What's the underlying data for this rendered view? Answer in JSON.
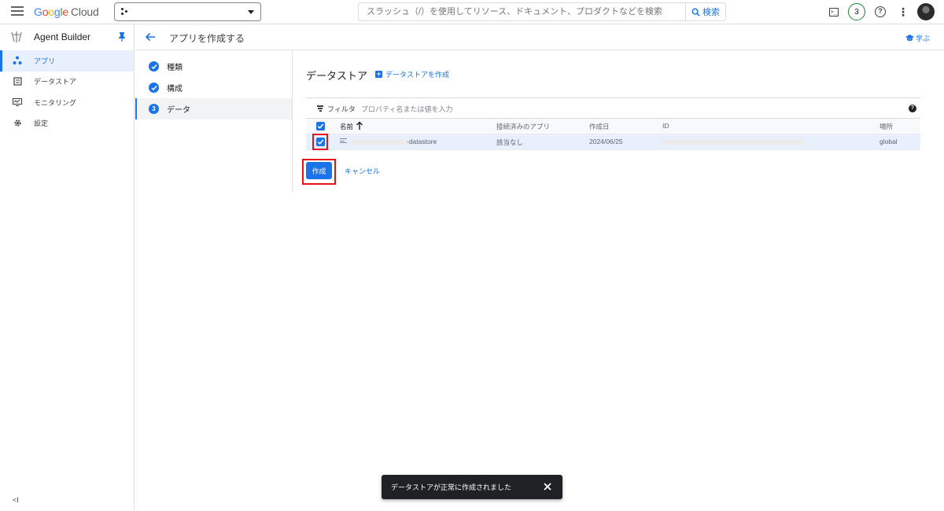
{
  "topbar": {
    "logo": {
      "g1": "G",
      "o1": "o",
      "o2": "o",
      "g2": "g",
      "l": "l",
      "e": "e",
      "cloud": "Cloud"
    },
    "search_placeholder": "スラッシュ（/）を使用してリソース、ドキュメント、プロダクトなどを検索",
    "search_button": "検索",
    "notification_count": "3",
    "help_glyph": "?",
    "more_glyph": "⋮",
    "terminal_glyph": ">_"
  },
  "sidebar": {
    "product_title": "Agent Builder",
    "items": [
      {
        "label": "アプリ",
        "icon": "apps-icon",
        "active": true
      },
      {
        "label": "データストア",
        "icon": "datastore-icon",
        "active": false
      },
      {
        "label": "モニタリング",
        "icon": "monitoring-icon",
        "active": false
      },
      {
        "label": "設定",
        "icon": "gear-icon",
        "active": false
      }
    ],
    "collapse_label": "<I"
  },
  "header": {
    "title": "アプリを作成する",
    "learn": "学ぶ"
  },
  "stepper": {
    "steps": [
      {
        "label": "種類",
        "status": "done"
      },
      {
        "label": "構成",
        "status": "done"
      },
      {
        "label": "データ",
        "status": "current",
        "number": "3"
      }
    ]
  },
  "main": {
    "section_title": "データストア",
    "create_datastore": "データストアを作成",
    "filter_label": "フィルタ",
    "filter_placeholder": "プロパティ名または値を入力",
    "filter_help": "?",
    "columns": [
      "名前",
      "接続済みのアプリ",
      "作成日",
      "ID",
      "場所"
    ],
    "rows": [
      {
        "name": "-datastore",
        "connected_apps": "該当なし",
        "created": "2024/06/25",
        "location": "global",
        "selected": true
      }
    ],
    "create_button": "作成",
    "cancel_button": "キャンセル"
  },
  "snackbar": {
    "message": "データストアが正常に作成されました",
    "close": "✕"
  },
  "colors": {
    "accent": "#1a73e8",
    "highlight": "#e8101a",
    "snackbar_bg": "#202124"
  }
}
